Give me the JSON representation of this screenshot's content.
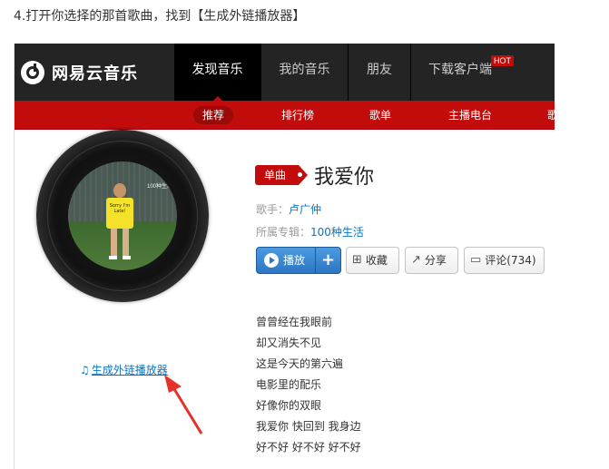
{
  "step_text": "4.打开你选择的那首歌曲，找到【生成外链播放器】",
  "header": {
    "logo": "网易云音乐",
    "nav": [
      "发现音乐",
      "我的音乐",
      "朋友",
      "下载客户端"
    ],
    "hot_badge": "HOT",
    "subnav": [
      "推荐",
      "排行榜",
      "歌单",
      "主播电台",
      "歌"
    ]
  },
  "song": {
    "type_badge": "单曲",
    "title": "我爱你",
    "singer_label": "歌手：",
    "singer": "卢广仲",
    "album_label": "所属专辑：",
    "album": "100种生活",
    "cover_tag": "100种生活",
    "cover_shirt": "Sorry I'm Late!"
  },
  "actions": {
    "play": "播放",
    "plus": "+",
    "collect": "收藏",
    "share": "分享",
    "comment": "评论(734)"
  },
  "external_link": "生成外链播放器",
  "lyrics": [
    "曾曾经在我眼前",
    "却又消失不见",
    "这是今天的第六遍",
    "电影里的配乐",
    "好像你的双眼",
    "我爱你 快回到 我身边",
    "好不好 好不好 好不好"
  ],
  "colors": {
    "brand_red": "#c20c0c",
    "topbar": "#242424",
    "link_blue": "#0c73c2",
    "play_blue": "#2d76c2"
  }
}
